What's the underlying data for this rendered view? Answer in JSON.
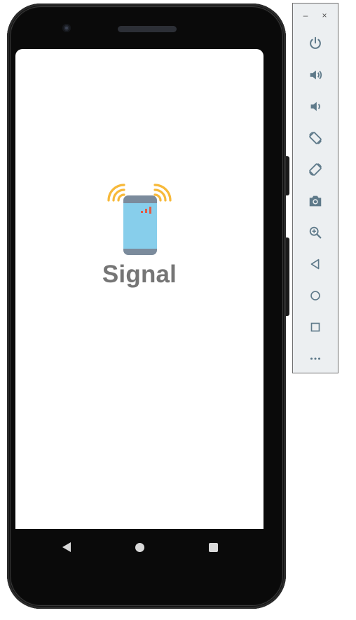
{
  "app": {
    "name": "Signal"
  },
  "emulator": {
    "window_controls": [
      {
        "name": "minimize",
        "glyph": "–"
      },
      {
        "name": "close",
        "glyph": "×"
      }
    ],
    "toolbar_icons": [
      "power-icon",
      "volume-up-icon",
      "volume-down-icon",
      "rotate-left-icon",
      "rotate-right-icon",
      "camera-icon",
      "zoom-icon",
      "back-icon",
      "home-icon",
      "overview-icon",
      "more-icon"
    ]
  },
  "navigation_bar": [
    "back-icon",
    "home-icon",
    "recents-icon"
  ],
  "colors": {
    "logo_waves": "#f7b93a",
    "logo_phone_body": "#7b8b9c",
    "logo_screen": "#87ceeb",
    "logo_signal_bars": "#e25b45",
    "app_name_text": "#757575",
    "toolbar_icon": "#5f7a8a"
  }
}
